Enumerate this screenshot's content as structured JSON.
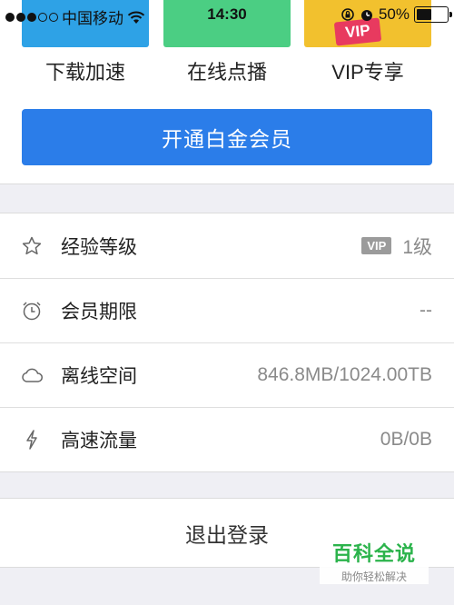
{
  "status": {
    "carrier": "中国移动",
    "time": "14:30",
    "battery": "50%",
    "battery_level": 0.5
  },
  "features": [
    {
      "label": "下载加速",
      "color": "#2ea2e6"
    },
    {
      "label": "在线点播",
      "color": "#4bce83"
    },
    {
      "label": "VIP专享",
      "color": "#f2c12e",
      "tag": "VIP"
    }
  ],
  "open_button": "开通白金会员",
  "info": {
    "level": {
      "label": "经验等级",
      "badge": "VIP",
      "value": "1级",
      "icon": "star-icon"
    },
    "expiry": {
      "label": "会员期限",
      "value": "--",
      "icon": "alarm-clock-icon"
    },
    "offline": {
      "label": "离线空间",
      "value": "846.8MB/1024.00TB",
      "icon": "cloud-icon"
    },
    "traffic": {
      "label": "高速流量",
      "value": "0B/0B",
      "icon": "lightning-icon"
    }
  },
  "logout": "退出登录",
  "watermark": {
    "title": "百科全说",
    "subtitle": "助你轻松解决"
  }
}
